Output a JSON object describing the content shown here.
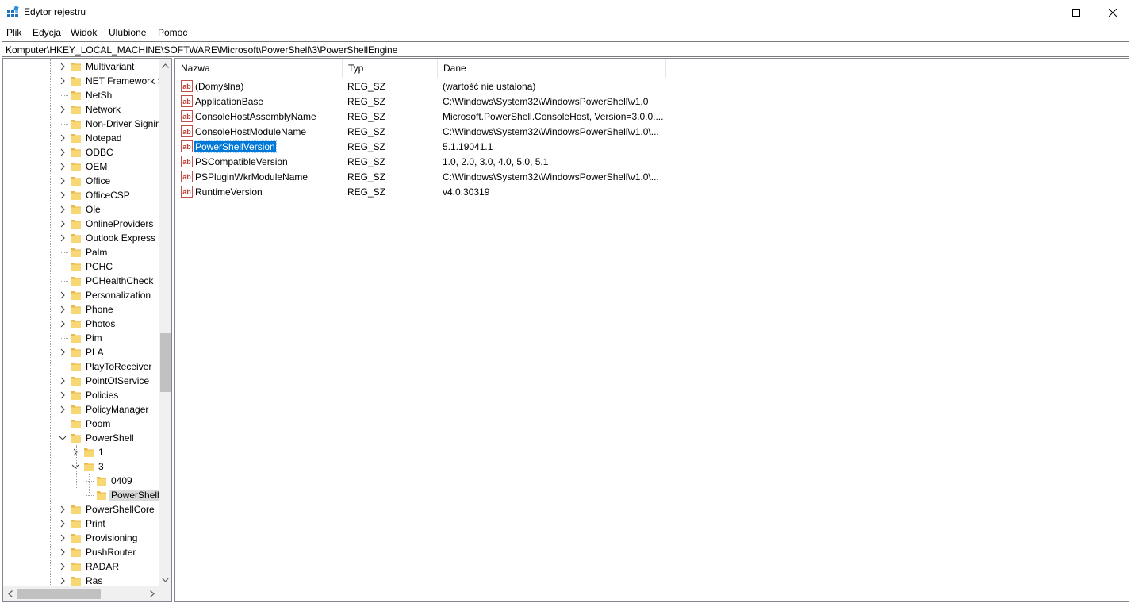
{
  "window": {
    "title": "Edytor rejestru",
    "controls": [
      "minimize-icon",
      "maximize-icon",
      "close-icon"
    ]
  },
  "menu": [
    "Plik",
    "Edycja",
    "Widok",
    "Ulubione",
    "Pomoc"
  ],
  "address": "Komputer\\HKEY_LOCAL_MACHINE\\SOFTWARE\\Microsoft\\PowerShell\\3\\PowerShellEngine",
  "tree": {
    "items": [
      {
        "label": "Multivariant",
        "expander": "collapsed"
      },
      {
        "label": "NET Framework S",
        "expander": "collapsed"
      },
      {
        "label": "NetSh",
        "expander": "none"
      },
      {
        "label": "Network",
        "expander": "collapsed"
      },
      {
        "label": "Non-Driver Signin",
        "expander": "none"
      },
      {
        "label": "Notepad",
        "expander": "collapsed"
      },
      {
        "label": "ODBC",
        "expander": "collapsed"
      },
      {
        "label": "OEM",
        "expander": "collapsed"
      },
      {
        "label": "Office",
        "expander": "collapsed"
      },
      {
        "label": "OfficeCSP",
        "expander": "collapsed"
      },
      {
        "label": "Ole",
        "expander": "collapsed"
      },
      {
        "label": "OnlineProviders",
        "expander": "collapsed"
      },
      {
        "label": "Outlook Express",
        "expander": "collapsed"
      },
      {
        "label": "Palm",
        "expander": "none"
      },
      {
        "label": "PCHC",
        "expander": "none"
      },
      {
        "label": "PCHealthCheck",
        "expander": "none"
      },
      {
        "label": "Personalization",
        "expander": "collapsed"
      },
      {
        "label": "Phone",
        "expander": "collapsed"
      },
      {
        "label": "Photos",
        "expander": "collapsed"
      },
      {
        "label": "Pim",
        "expander": "none"
      },
      {
        "label": "PLA",
        "expander": "collapsed"
      },
      {
        "label": "PlayToReceiver",
        "expander": "none"
      },
      {
        "label": "PointOfService",
        "expander": "collapsed"
      },
      {
        "label": "Policies",
        "expander": "collapsed"
      },
      {
        "label": "PolicyManager",
        "expander": "collapsed"
      },
      {
        "label": "Poom",
        "expander": "none"
      },
      {
        "label": "PowerShell",
        "expander": "expanded"
      },
      {
        "label": "1",
        "expander": "collapsed"
      },
      {
        "label": "3",
        "expander": "expanded"
      },
      {
        "label": "0409",
        "expander": "none"
      },
      {
        "label": "PowerShell",
        "expander": "none",
        "selected": true
      },
      {
        "label": "PowerShellCore",
        "expander": "collapsed"
      },
      {
        "label": "Print",
        "expander": "collapsed"
      },
      {
        "label": "Provisioning",
        "expander": "collapsed"
      },
      {
        "label": "PushRouter",
        "expander": "collapsed"
      },
      {
        "label": "RADAR",
        "expander": "collapsed"
      },
      {
        "label": "Ras",
        "expander": "collapsed"
      }
    ]
  },
  "columns": [
    "Nazwa",
    "Typ",
    "Dane"
  ],
  "values": [
    {
      "name": "(Domyślna)",
      "type": "REG_SZ",
      "data": "(wartość nie ustalona)"
    },
    {
      "name": "ApplicationBase",
      "type": "REG_SZ",
      "data": "C:\\Windows\\System32\\WindowsPowerShell\\v1.0"
    },
    {
      "name": "ConsoleHostAssemblyName",
      "type": "REG_SZ",
      "data": "Microsoft.PowerShell.ConsoleHost, Version=3.0.0...."
    },
    {
      "name": "ConsoleHostModuleName",
      "type": "REG_SZ",
      "data": "C:\\Windows\\System32\\WindowsPowerShell\\v1.0\\..."
    },
    {
      "name": "PowerShellVersion",
      "type": "REG_SZ",
      "data": "5.1.19041.1",
      "selected": true
    },
    {
      "name": "PSCompatibleVersion",
      "type": "REG_SZ",
      "data": "1.0, 2.0, 3.0, 4.0, 5.0, 5.1"
    },
    {
      "name": "PSPluginWkrModuleName",
      "type": "REG_SZ",
      "data": "C:\\Windows\\System32\\WindowsPowerShell\\v1.0\\..."
    },
    {
      "name": "RuntimeVersion",
      "type": "REG_SZ",
      "data": "v4.0.30319"
    }
  ],
  "colors": {
    "selection": "#0078d7",
    "folder": "#f8d775",
    "folder_dark": "#e7b84a",
    "tree_selection": "#d9d9d9"
  },
  "icons": {
    "app": "registry-editor-icon",
    "folder": "folder-icon",
    "string_value": "string-value-icon"
  }
}
